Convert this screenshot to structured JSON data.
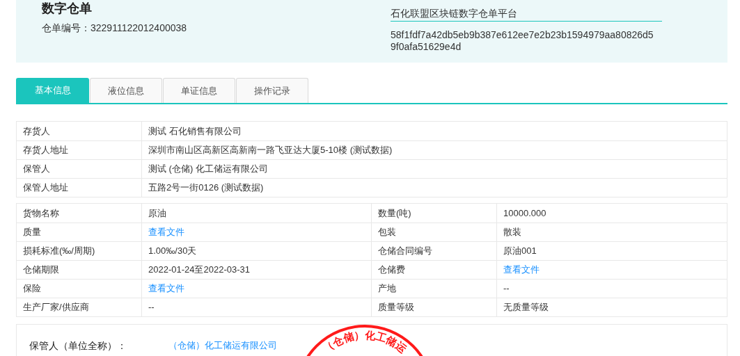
{
  "header": {
    "title": "数字仓单",
    "number_label": "仓单编号：",
    "number": "322911122012400038",
    "platform": "石化联盟区块链数字仓单平台",
    "hash": "58f1fdf7a42db5eb9b387e612ee7e2b23b1594979aa80826d59f0afa51629e4d"
  },
  "tabs": [
    {
      "label": "基本信息",
      "selected": true
    },
    {
      "label": "液位信息",
      "selected": false
    },
    {
      "label": "单证信息",
      "selected": false
    },
    {
      "label": "操作记录",
      "selected": false
    }
  ],
  "parties": [
    {
      "label": "存货人",
      "value": "测试 石化销售有限公司"
    },
    {
      "label": "存货人地址",
      "value": "深圳市南山区高新区高新南一路飞亚达大厦5-10楼 (测试数据)"
    },
    {
      "label": "保管人",
      "value": "测试 (仓储) 化工储运有限公司"
    },
    {
      "label": "保管人地址",
      "value": "五路2号一街0126 (测试数据)"
    }
  ],
  "goods": [
    [
      {
        "label": "货物名称",
        "value": "原油",
        "kind": "text"
      },
      {
        "label": "数量(吨)",
        "value": "10000.000",
        "kind": "text"
      }
    ],
    [
      {
        "label": "质量",
        "value": "查看文件",
        "kind": "link"
      },
      {
        "label": "包装",
        "value": "散装",
        "kind": "text"
      }
    ],
    [
      {
        "label": "损耗标准(‰/周期)",
        "value": "1.00‰/30天",
        "kind": "text"
      },
      {
        "label": "仓储合同编号",
        "value": "原油001",
        "kind": "text"
      }
    ],
    [
      {
        "label": "仓储期限",
        "value": "2022-01-24至2022-03-31",
        "kind": "text"
      },
      {
        "label": "仓储费",
        "value": "查看文件",
        "kind": "link"
      }
    ],
    [
      {
        "label": "保险",
        "value": "查看文件",
        "kind": "link"
      },
      {
        "label": "产地",
        "value": "--",
        "kind": "text"
      }
    ],
    [
      {
        "label": "生产厂家/供应商",
        "value": "--",
        "kind": "text"
      },
      {
        "label": "质量等级",
        "value": "无质量等级",
        "kind": "text"
      }
    ]
  ],
  "signature": {
    "label": "保管人（单位全称）：",
    "value": "（仓储）化工储运有限公司",
    "seal_text": "（仓储）化工储运"
  }
}
